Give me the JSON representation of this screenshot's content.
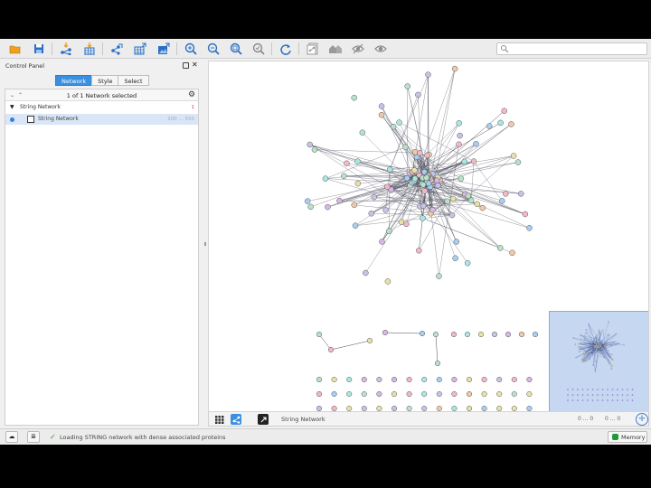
{
  "toolbar": {
    "buttons": [
      "open-session",
      "save-session",
      "import-network",
      "import-table",
      "export-network",
      "export-table",
      "export-image",
      "zoom-in",
      "zoom-out",
      "zoom-fit",
      "zoom-selected",
      "refresh",
      "new-network-from-selection",
      "home",
      "hide-selected",
      "show-all"
    ],
    "search_placeholder": ""
  },
  "control_panel": {
    "title": "Control Panel",
    "tabs": [
      {
        "label": "Network",
        "active": true
      },
      {
        "label": "Style",
        "active": false
      },
      {
        "label": "Select",
        "active": false
      }
    ],
    "selection_summary": "1 of 1 Network selected",
    "tree": {
      "root_label": "String Network",
      "root_count": "1",
      "child_label": "String Network",
      "child_counts": "200 ... 550"
    }
  },
  "canvas": {
    "network_name": "String Network",
    "node_stats": "0 ... 0",
    "edge_stats": "0 ... 0"
  },
  "status": {
    "message": "Loading STRING network with dense associated proteins",
    "memory_label": "Memory"
  },
  "colors": {
    "accent": "#3b8fe0",
    "node_fill": "#c9c2e8",
    "edge": "#555555",
    "birdseye_bg": "#c6d7f2",
    "ok_green": "#2a9a2a"
  }
}
